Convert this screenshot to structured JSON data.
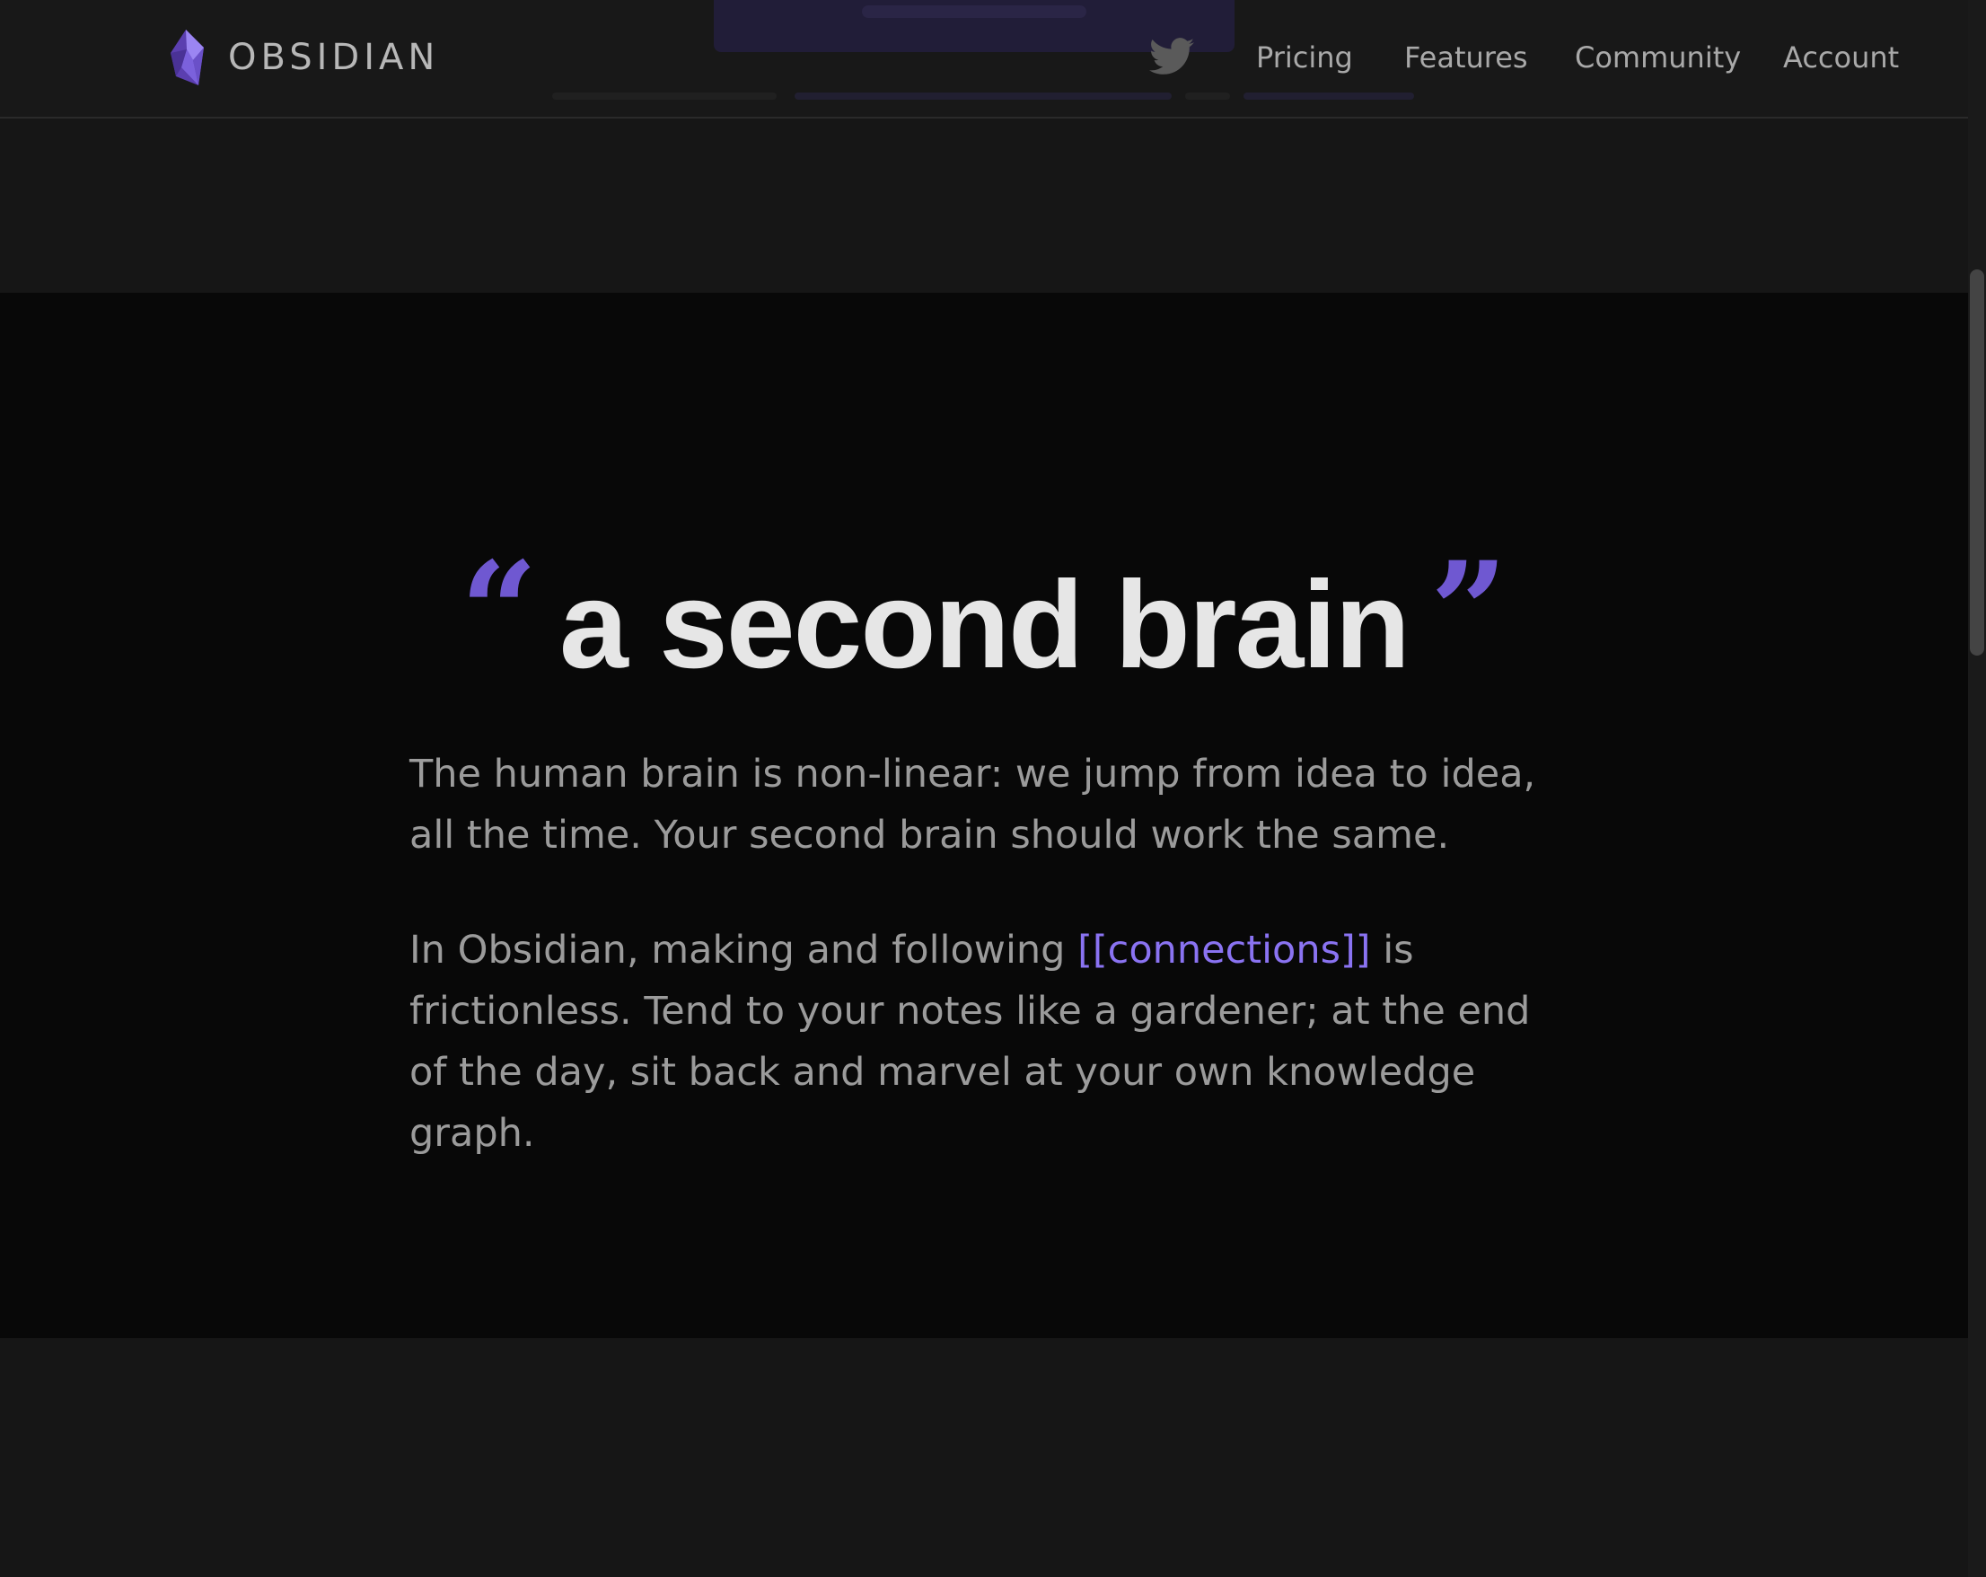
{
  "brand": {
    "name": "OBSIDIAN",
    "accent": "#7c64e6"
  },
  "nav": {
    "links": [
      "Pricing",
      "Features",
      "Community",
      "Account"
    ]
  },
  "icons": {
    "logo": "obsidian-crystal-icon",
    "social": "twitter-icon"
  },
  "section": {
    "open_quote": "“",
    "close_quote": "”",
    "title": "a second brain",
    "paragraph1": "The human brain is non-linear: we jump from idea to idea, all the time. Your second brain should work the same.",
    "paragraph2_before": "In Obsidian, making and following ",
    "paragraph2_link": "[[connections]]",
    "paragraph2_after": " is frictionless. Tend to your notes like a gardener; at the end of the day, sit back and marvel at your own knowledge graph."
  }
}
